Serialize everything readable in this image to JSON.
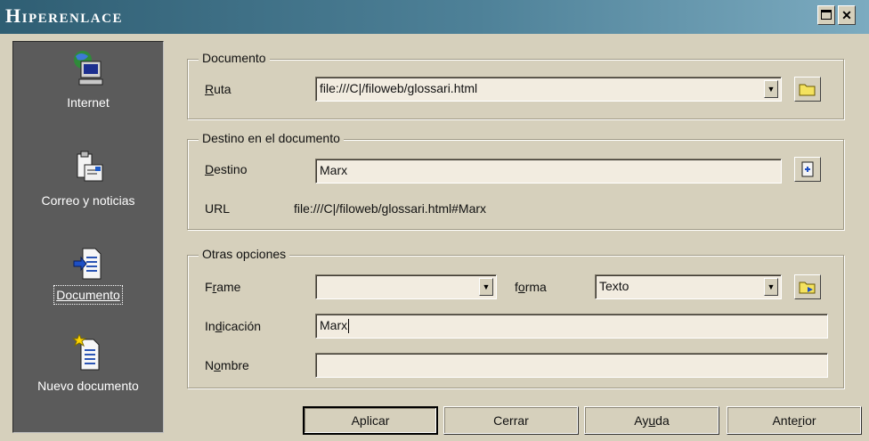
{
  "window": {
    "title": "Hiperenlace"
  },
  "sidebar": {
    "items": [
      {
        "label": "Internet",
        "icon": "internet-globe-icon"
      },
      {
        "label": "Correo y noticias",
        "icon": "mail-news-icon"
      },
      {
        "label": "Documento",
        "icon": "document-icon",
        "active": true
      },
      {
        "label": "Nuevo documento",
        "icon": "new-document-icon"
      }
    ]
  },
  "documento": {
    "legend": "Documento",
    "ruta_label_underlined": "R",
    "ruta_label_rest": "uta",
    "ruta_value": "file:///C|/filoweb/glossari.html"
  },
  "destino": {
    "legend": "Destino en el documento",
    "destino_label_underlined": "D",
    "destino_label_rest": "estino",
    "destino_value": "Marx",
    "url_label": "URL",
    "url_value": "file:///C|/filoweb/glossari.html#Marx"
  },
  "otras": {
    "legend": "Otras opciones",
    "frame_label_pre": "F",
    "frame_label_underlined": "r",
    "frame_label_post": "ame",
    "frame_value": "",
    "forma_label_pre": "f",
    "forma_label_underlined": "o",
    "forma_label_post": "rma",
    "forma_value": "Texto",
    "indicacion_label_pre": "In",
    "indicacion_label_underlined": "d",
    "indicacion_label_post": "icación",
    "indicacion_value": "Marx",
    "nombre_label_pre": "N",
    "nombre_label_underlined": "o",
    "nombre_label_post": "mbre",
    "nombre_value": ""
  },
  "buttons": {
    "aplicar": "Aplicar",
    "cerrar": "Cerrar",
    "ayuda_pre": "Ay",
    "ayuda_underlined": "u",
    "ayuda_post": "da",
    "anterior_pre": "Ante",
    "anterior_underlined": "r",
    "anterior_post": "ior"
  }
}
